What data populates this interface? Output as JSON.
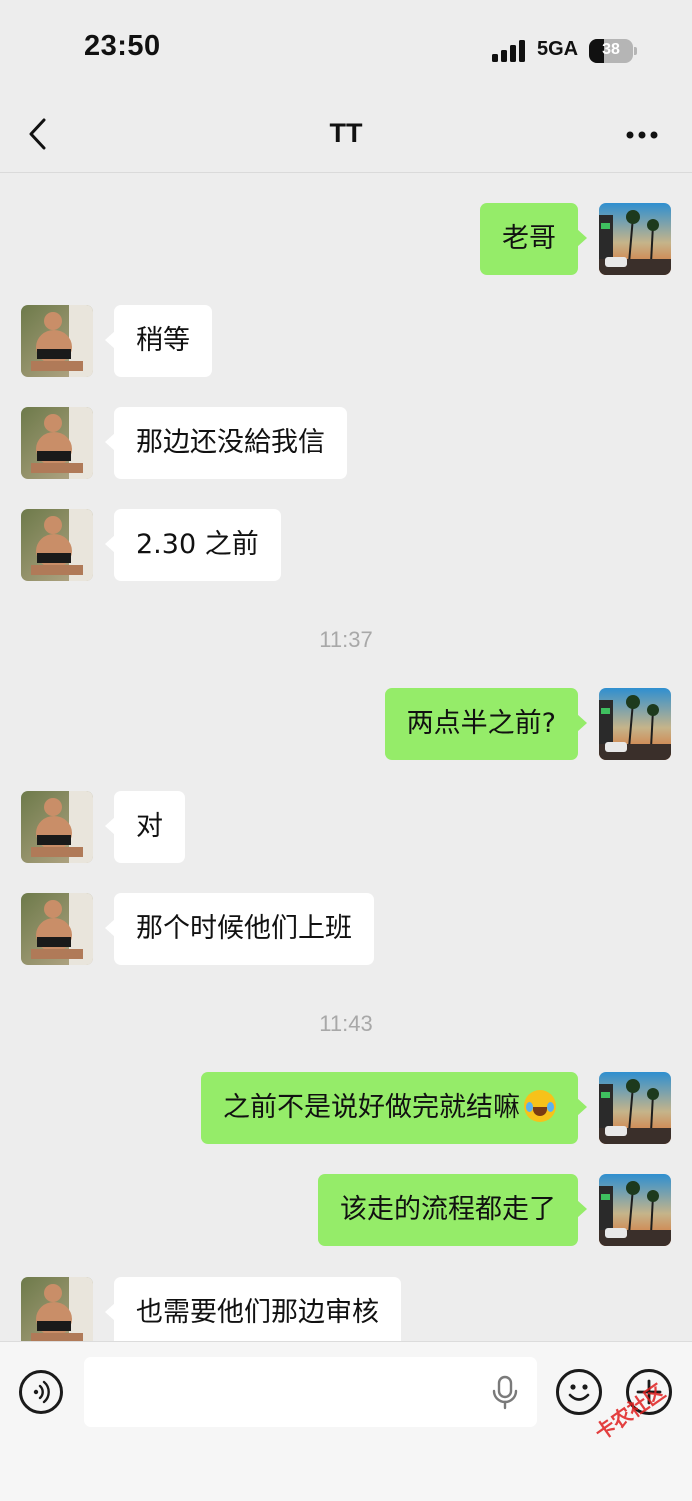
{
  "status_bar": {
    "time": "23:50",
    "network": "5GA",
    "battery": "38",
    "battery_level": 0.38
  },
  "nav": {
    "title": "TT",
    "back_icon": "chevron-left-icon",
    "more_icon": "more-dots-icon"
  },
  "messages": [
    {
      "side": "out",
      "text": "老哥"
    },
    {
      "side": "in",
      "text": "稍等"
    },
    {
      "side": "in",
      "text": "那边还没給我信"
    },
    {
      "side": "in",
      "text": "2.30 之前"
    },
    {
      "timestamp": "11:37"
    },
    {
      "side": "out",
      "text": "两点半之前?"
    },
    {
      "side": "in",
      "text": "对"
    },
    {
      "side": "in",
      "text": "那个时候他们上班"
    },
    {
      "timestamp": "11:43"
    },
    {
      "side": "out",
      "text": "之前不是说好做完就结嘛",
      "emoji": "crying-laughing-emoji"
    },
    {
      "side": "out",
      "text": "该走的流程都走了"
    },
    {
      "side": "in",
      "text": "也需要他们那边审核"
    }
  ],
  "input_bar": {
    "placeholder": "",
    "value": "",
    "voice_icon": "voice-icon",
    "mic_icon": "microphone-icon",
    "emoji_icon": "smiley-icon",
    "plus_icon": "plus-icon"
  },
  "watermark": "卡农社区",
  "colors": {
    "background": "#ededed",
    "outgoing_bubble": "#95ec69",
    "incoming_bubble": "#ffffff"
  }
}
